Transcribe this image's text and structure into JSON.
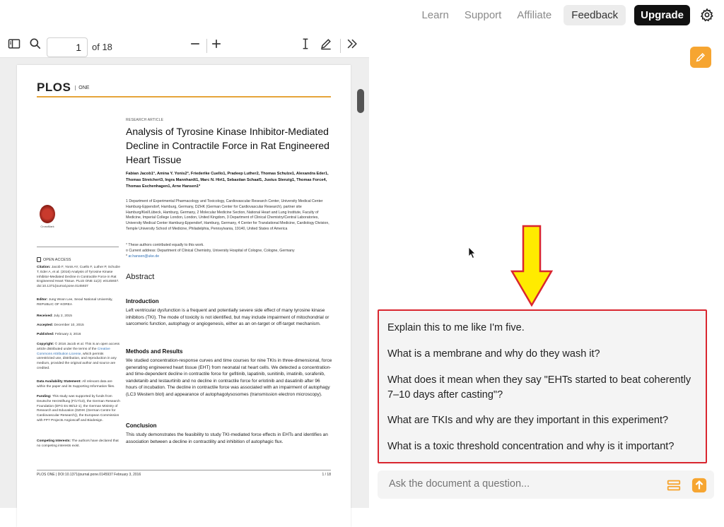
{
  "topnav": {
    "links": [
      "Learn",
      "Support",
      "Affiliate"
    ],
    "feedback_label": "Feedback",
    "upgrade_label": "Upgrade"
  },
  "toolbar": {
    "page_number": "1",
    "page_total": "of 18"
  },
  "paper": {
    "journal": "PLOS",
    "journal_suffix": "ONE",
    "article_type": "RESEARCH ARTICLE",
    "title": "Analysis of Tyrosine Kinase Inhibitor-Mediated Decline in Contractile Force in Rat Engineered Heart Tissue",
    "authors": "Fabian Jacob1°, Amina Y. Yonis2°, Friederike Cuello1, Pradeep Luther2, Thomas Schulze1, Alexandra Eder1, Thomas Streichert3, Ingra Mannhardt1, Marc N. Hirt1, Sebastian Schaaf1, Justus Stenzig1, Thomas Force4, Thomas Eschenhagen1, Arne Hansen1*",
    "affiliations": "1 Department of Experimental Pharmacology and Toxicology, Cardiovascular Research Center, University Medical Center Hamburg-Eppendorf, Hamburg, Germany, DZHK (German Center for Cardiovascular Research), partner site Hamburg/Kiel/Lübeck, Hamburg, Germany, 2 Molecular Medicine Section, National Heart and Lung Institute, Faculty of Medicine, Imperial College London, London, United Kingdom, 3 Department of Clinical Chemistry/Central Laboratories, University Medical Center Hamburg-Eppendorf, Hamburg, Germany, 4 Center for Translational Medicine, Cardiology Division, Temple University School of Medicine, Philadelphia, Pennsylvania, 19140, United States of America",
    "note_equal": "° These authors contributed equally to this work.",
    "note_address": "¤ Current address: Department of Clinical Chemistry, University Hospital of Cologne, Cologne, Germany",
    "email": "ar.hansen@uke.de",
    "abstract_heading": "Abstract",
    "intro_heading": "Introduction",
    "intro_text": "Left ventricular dysfunction is a frequent and potentially severe side effect of many tyrosine kinase inhibitors (TKI). The mode of toxicity is not identified, but may include impairment of mitochondrial or sarcomeric function, autophagy or angiogenesis, either as an on-target or off-target mechanism.",
    "methods_heading": "Methods and Results",
    "methods_text": "We studied concentration-response curves and time courses for nine TKIs in three-dimensional, force generating engineered heart tissue (EHT) from neonatal rat heart cells. We detected a concentration- and time-dependent decline in contractile force for gefitinib, lapatinib, sunitinib, imatinib, sorafenib, vandetanib and lestaurtinib and no decline in contractile force for erlotinib and dasatinib after 96 hours of incubation. The decline in contractile force was associated with an impairment of autophagy (LC3 Western blot) and appearance of autophagolysosomes (transmission electron microscopy).",
    "conclusion_heading": "Conclusion",
    "conclusion_text": "This study demonstrates the feasibility to study TKI-mediated force effects in EHTs and identifies an association between a decline in contractility and inhibition of autophagic flux.",
    "crossmark": "CrossMark",
    "open_access": "OPEN ACCESS",
    "citation": "Jacob F, Yonis AY, Cuello F, Luther P, Schulze T, Eder A, et al. (2016) Analysis of Tyrosine Kinase Inhibitor-Mediated Decline in Contractile Force in Rat Engineered Heart Tissue. PLoS ONE 11(2): e0145937. doi:10.1371/journal.pone.0145937",
    "editor": "Jung Woon Lee, Seoul National University, REPUBLIC OF KOREA",
    "received": "July 2, 2015",
    "accepted": "December 10, 2015",
    "published": "February 3, 2016",
    "copyright_a": "© 2016 Jacob et al. This is an open access article distributed under the terms of the",
    "copyright_link": "Creative Commons Attribution License",
    "copyright_b": ", which permits unrestricted use, distribution, and reproduction in any medium, provided the original author and source are credited.",
    "data_availability": "All relevant data are within the paper and its Supporting Information files.",
    "funding": "This study was supported by funds from Deutsche Herzstiftung (F/17/13), the German Research Foundation (DFG Es 88/12-1), the German Ministry of Research and Education (DZHK (German Centre for Cardiovascular Research)), the European Commission with FP7 Projects Angioscaff and Biodesign.",
    "competing": "The authors have declared that no competing interests exist.",
    "footer_left": "PLOS ONE | DOI:10.1371/journal.pone.0145937    February 3, 2016",
    "footer_right": "1 / 18"
  },
  "chat": {
    "suggestions": [
      "Explain this to me like I'm five.",
      "What is a membrane and why do they wash it?",
      "What does it mean when they say \"EHTs started to beat coherently 7–10 days after casting\"?",
      "What are TKIs and why are they important in this experiment?",
      "What is a toxic threshold concentration and why is it important?"
    ],
    "input_placeholder": "Ask the document a question..."
  },
  "colors": {
    "accent_orange": "#f6a531",
    "highlight_red": "#d9262f",
    "arrow_yellow": "#ffeb00",
    "plos_rule": "#e6a53a"
  },
  "icons": [
    "sidebar-toggle-icon",
    "search-icon",
    "zoom-out-icon",
    "zoom-in-icon",
    "text-cursor-icon",
    "pen-icon",
    "expand-icon",
    "gear-icon",
    "edit-icon",
    "list-icon",
    "send-icon"
  ]
}
